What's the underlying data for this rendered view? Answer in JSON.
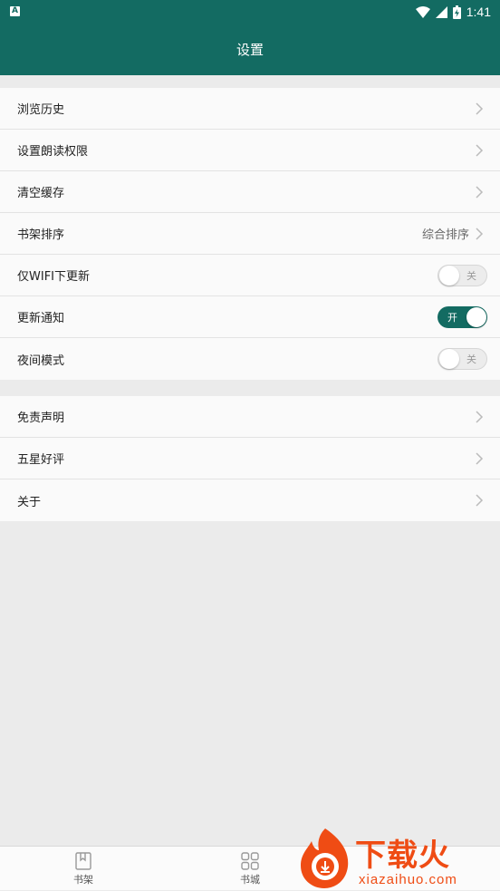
{
  "status_bar": {
    "time": "1:41",
    "app_badge": "A"
  },
  "header": {
    "title": "设置"
  },
  "group1": [
    {
      "label": "浏览历史",
      "type": "link"
    },
    {
      "label": "设置朗读权限",
      "type": "link"
    },
    {
      "label": "清空缓存",
      "type": "link"
    },
    {
      "label": "书架排序",
      "type": "link",
      "value": "综合排序"
    },
    {
      "label": "仅WIFI下更新",
      "type": "toggle",
      "state": "off",
      "state_text": "关"
    },
    {
      "label": "更新通知",
      "type": "toggle",
      "state": "on",
      "state_text": "开"
    },
    {
      "label": "夜间模式",
      "type": "toggle",
      "state": "off",
      "state_text": "关"
    }
  ],
  "group2": [
    {
      "label": "免责声明",
      "type": "link"
    },
    {
      "label": "五星好评",
      "type": "link"
    },
    {
      "label": "关于",
      "type": "link"
    }
  ],
  "bottom_nav": [
    {
      "label": "书架",
      "icon": "bookshelf-icon"
    },
    {
      "label": "书城",
      "icon": "grid-icon"
    }
  ],
  "watermark": {
    "text": "下载火",
    "sub": "xiazaihuo.com"
  },
  "colors": {
    "primary": "#136b62",
    "background": "#ebebeb",
    "accent": "#ef4c14"
  }
}
